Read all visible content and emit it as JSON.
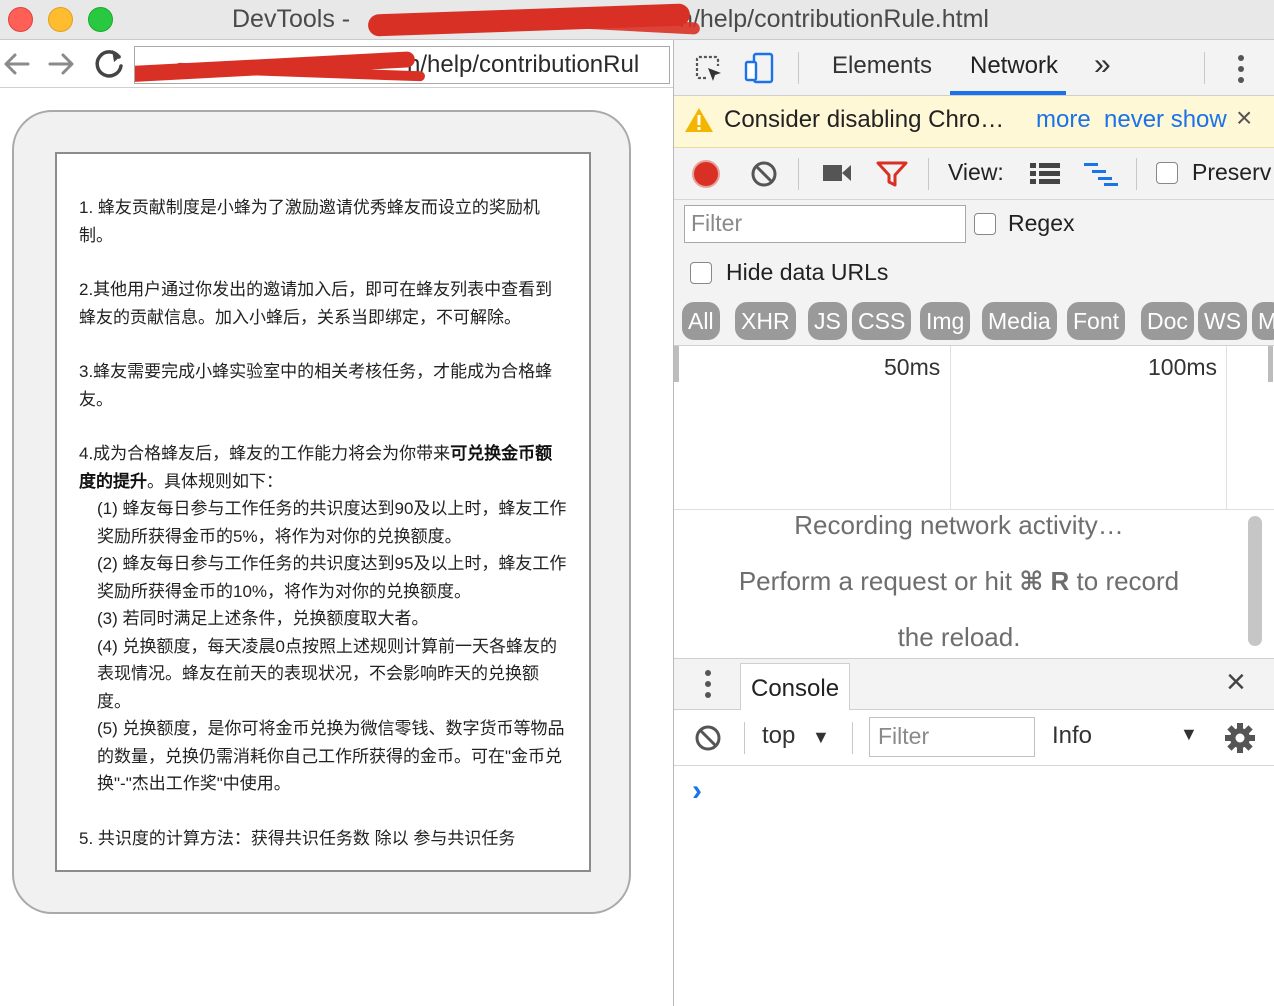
{
  "window": {
    "title_prefix": "DevTools - ",
    "title_suffix": "n/help/contributionRule.html"
  },
  "browser": {
    "url_suffix": "n/help/contributionRul"
  },
  "page": {
    "para1": "1. 蜂友贡献制度是小蜂为了激励邀请优秀蜂友而设立的奖励机制。",
    "para2": "2.其他用户通过你发出的邀请加入后，即可在蜂友列表中查看到蜂友的贡献信息。加入小蜂后，关系当即绑定，不可解除。",
    "para3": "3.蜂友需要完成小蜂实验室中的相关考核任务，才能成为合格蜂友。",
    "para4_lead": "4.成为合格蜂友后，蜂友的工作能力将会为你带来",
    "para4_bold": "可兑换金币额度的提升",
    "para4_tail": "。具体规则如下：",
    "rule1": "(1) 蜂友每日参与工作任务的共识度达到90及以上时，蜂友工作奖励所获得金币的5%，将作为对你的兑换额度。",
    "rule2": "(2) 蜂友每日参与工作任务的共识度达到95及以上时，蜂友工作奖励所获得金币的10%，将作为对你的兑换额度。",
    "rule3": "(3) 若同时满足上述条件，兑换额度取大者。",
    "rule4": "(4) 兑换额度，每天凌晨0点按照上述规则计算前一天各蜂友的表现情况。蜂友在前天的表现状况，不会影响昨天的兑换额度。",
    "rule5": "(5) 兑换额度，是你可将金币兑换为微信零钱、数字货币等物品的数量，兑换仍需消耗你自己工作所获得的金币。可在\"金币兑换\"-\"杰出工作奖\"中使用。",
    "para5": "5. 共识度的计算方法：获得共识任务数 除以 参与共识任务"
  },
  "devtools": {
    "tabs": {
      "elements": "Elements",
      "network": "Network",
      "more": "»"
    },
    "warning": {
      "text": "Consider disabling Chro…",
      "more": "more",
      "never_show": "never show",
      "close": "×"
    },
    "toolbar": {
      "view_label": "View:",
      "preserve_label": "Preserv"
    },
    "filter": {
      "placeholder": "Filter",
      "regex_label": "Regex",
      "hide_data_urls": "Hide data URLs"
    },
    "type_filters": [
      "All",
      "XHR",
      "JS",
      "CSS",
      "Img",
      "Media",
      "Font",
      "Doc",
      "WS",
      "M"
    ],
    "timeline": {
      "tick1": "50ms",
      "tick2": "100ms"
    },
    "empty": {
      "line1": "Recording network activity…",
      "line2_pre": "Perform a request or hit ",
      "line2_key": "⌘ R",
      "line2_post": " to record",
      "line3": "the reload."
    },
    "console": {
      "tab": "Console",
      "close": "×",
      "context": "top",
      "filter_placeholder": "Filter",
      "level": "Info",
      "prompt": "›"
    },
    "colors": {
      "accent": "#1a73e8",
      "record": "#d93025",
      "warning_bg": "#fff8d6"
    }
  }
}
